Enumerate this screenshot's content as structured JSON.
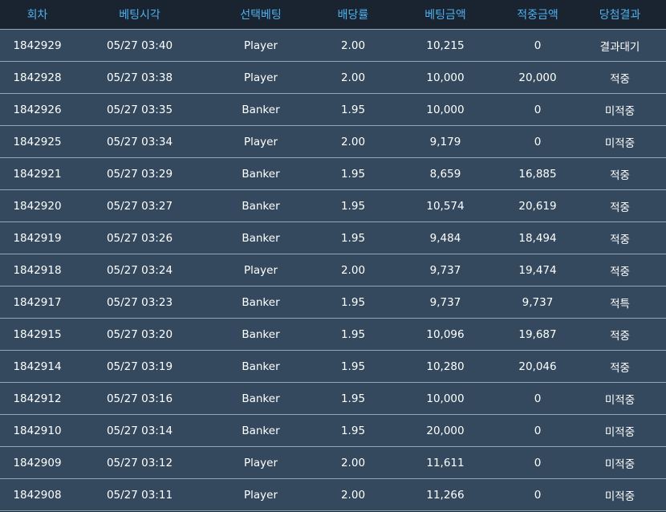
{
  "headers": [
    "회차",
    "베팅시각",
    "선택베팅",
    "배당률",
    "베팅금액",
    "적중금액",
    "당첨결과"
  ],
  "colors": {
    "header_bg": "#1a2431",
    "header_text": "#4fb0ee",
    "row_bg": "#34495e",
    "row_text": "#ffffff",
    "divider": "#8aa9bf",
    "status_orange": "#f5a623",
    "status_red": "#e82a2a"
  },
  "rows": [
    {
      "round": "1842929",
      "time": "05/27 03:40",
      "pick": "Player",
      "odds": "2.00",
      "bet": "10,215",
      "win": "0",
      "result": "결과대기",
      "status": "pending"
    },
    {
      "round": "1842928",
      "time": "05/27 03:38",
      "pick": "Player",
      "odds": "2.00",
      "bet": "10,000",
      "win": "20,000",
      "result": "적중",
      "status": "win"
    },
    {
      "round": "1842926",
      "time": "05/27 03:35",
      "pick": "Banker",
      "odds": "1.95",
      "bet": "10,000",
      "win": "0",
      "result": "미적중",
      "status": "lose"
    },
    {
      "round": "1842925",
      "time": "05/27 03:34",
      "pick": "Player",
      "odds": "2.00",
      "bet": "9,179",
      "win": "0",
      "result": "미적중",
      "status": "lose"
    },
    {
      "round": "1842921",
      "time": "05/27 03:29",
      "pick": "Banker",
      "odds": "1.95",
      "bet": "8,659",
      "win": "16,885",
      "result": "적중",
      "status": "win"
    },
    {
      "round": "1842920",
      "time": "05/27 03:27",
      "pick": "Banker",
      "odds": "1.95",
      "bet": "10,574",
      "win": "20,619",
      "result": "적중",
      "status": "win"
    },
    {
      "round": "1842919",
      "time": "05/27 03:26",
      "pick": "Banker",
      "odds": "1.95",
      "bet": "9,484",
      "win": "18,494",
      "result": "적중",
      "status": "win"
    },
    {
      "round": "1842918",
      "time": "05/27 03:24",
      "pick": "Player",
      "odds": "2.00",
      "bet": "9,737",
      "win": "19,474",
      "result": "적중",
      "status": "win"
    },
    {
      "round": "1842917",
      "time": "05/27 03:23",
      "pick": "Banker",
      "odds": "1.95",
      "bet": "9,737",
      "win": "9,737",
      "result": "적특",
      "status": "special"
    },
    {
      "round": "1842915",
      "time": "05/27 03:20",
      "pick": "Banker",
      "odds": "1.95",
      "bet": "10,096",
      "win": "19,687",
      "result": "적중",
      "status": "win"
    },
    {
      "round": "1842914",
      "time": "05/27 03:19",
      "pick": "Banker",
      "odds": "1.95",
      "bet": "10,280",
      "win": "20,046",
      "result": "적중",
      "status": "win"
    },
    {
      "round": "1842912",
      "time": "05/27 03:16",
      "pick": "Banker",
      "odds": "1.95",
      "bet": "10,000",
      "win": "0",
      "result": "미적중",
      "status": "lose"
    },
    {
      "round": "1842910",
      "time": "05/27 03:14",
      "pick": "Banker",
      "odds": "1.95",
      "bet": "20,000",
      "win": "0",
      "result": "미적중",
      "status": "lose"
    },
    {
      "round": "1842909",
      "time": "05/27 03:12",
      "pick": "Player",
      "odds": "2.00",
      "bet": "11,611",
      "win": "0",
      "result": "미적중",
      "status": "lose"
    },
    {
      "round": "1842908",
      "time": "05/27 03:11",
      "pick": "Player",
      "odds": "2.00",
      "bet": "11,266",
      "win": "0",
      "result": "미적중",
      "status": "lose"
    }
  ]
}
